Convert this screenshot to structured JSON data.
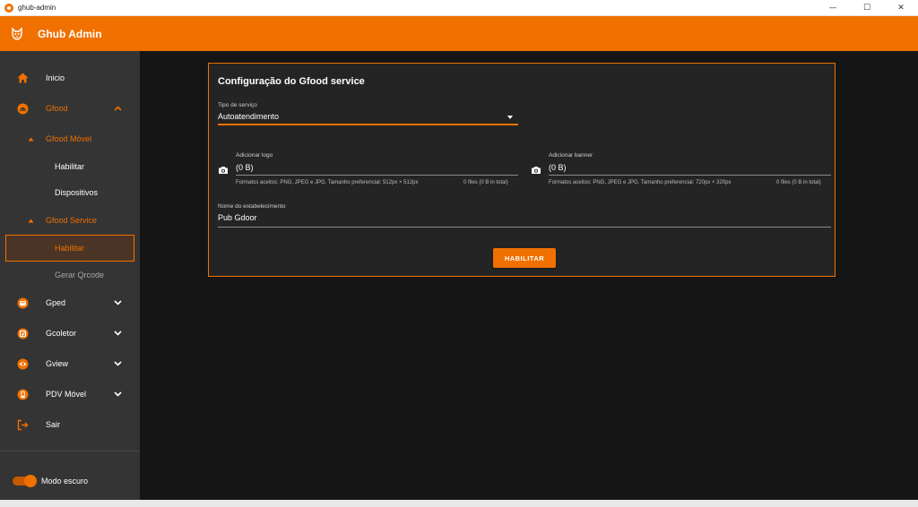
{
  "window": {
    "title": "ghub-admin",
    "controls": [
      "—",
      "☐",
      "✕"
    ]
  },
  "app": {
    "title": "Ghub Admin",
    "accent": "#f07000"
  },
  "sidebar": {
    "items": [
      {
        "label": "Inicio",
        "icon": "home-icon"
      },
      {
        "label": "Gfood",
        "icon": "gfood-icon"
      },
      {
        "label": "Gfood Móvel"
      },
      {
        "label": "Habilitar"
      },
      {
        "label": "Dispositivos"
      },
      {
        "label": "Gfood Service"
      },
      {
        "label": "Habilitar"
      },
      {
        "label": "Gerar Qrcode"
      },
      {
        "label": "Gped",
        "icon": "gped-icon"
      },
      {
        "label": "Gcoletor",
        "icon": "gcoletor-icon"
      },
      {
        "label": "Gview",
        "icon": "gview-icon"
      },
      {
        "label": "PDV Móvel",
        "icon": "pdv-icon"
      },
      {
        "label": "Sair",
        "icon": "logout-icon"
      }
    ],
    "dark_mode_label": "Modo escuro",
    "dark_mode_on": true
  },
  "main": {
    "title": "Configuração do Gfood service",
    "service_type": {
      "label": "Tipo de serviço",
      "value": "Autoatendimento"
    },
    "logo": {
      "label": "Adicionar logo",
      "value": "(0 B)",
      "helper": "Formatos aceitos: PNG, JPEG e JPG. Tamanho preferencial: 512px × 512px",
      "count": "0 files (0 B in total)"
    },
    "banner": {
      "label": "Adicionar banner",
      "value": "(0 B)",
      "helper": "Formatos aceitos: PNG, JPEG e JPG. Tamanho preferencial: 720px × 320px",
      "count": "0 files (0 B in total)"
    },
    "establishment": {
      "label": "Nome do estabelecimento",
      "value": "Pub Gdoor"
    },
    "submit_label": "HABILITAR"
  }
}
